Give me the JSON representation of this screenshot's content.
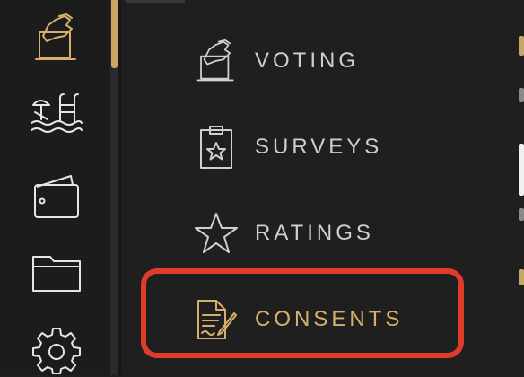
{
  "colors": {
    "accent": "#d6b06a",
    "highlight": "#e03c2b",
    "text": "#cfcfcf"
  },
  "rail": {
    "icons": [
      "voting-hand-ballot-icon",
      "beach-pool-icon",
      "wallet-icon",
      "folder-icon",
      "gear-icon"
    ]
  },
  "menu": {
    "items": [
      {
        "label": "VOTING",
        "icon": "voting-hand-ballot-icon"
      },
      {
        "label": "SURVEYS",
        "icon": "clipboard-star-icon"
      },
      {
        "label": "RATINGS",
        "icon": "star-icon"
      },
      {
        "label": "CONSENTS",
        "icon": "signed-document-icon",
        "active": true
      }
    ]
  }
}
